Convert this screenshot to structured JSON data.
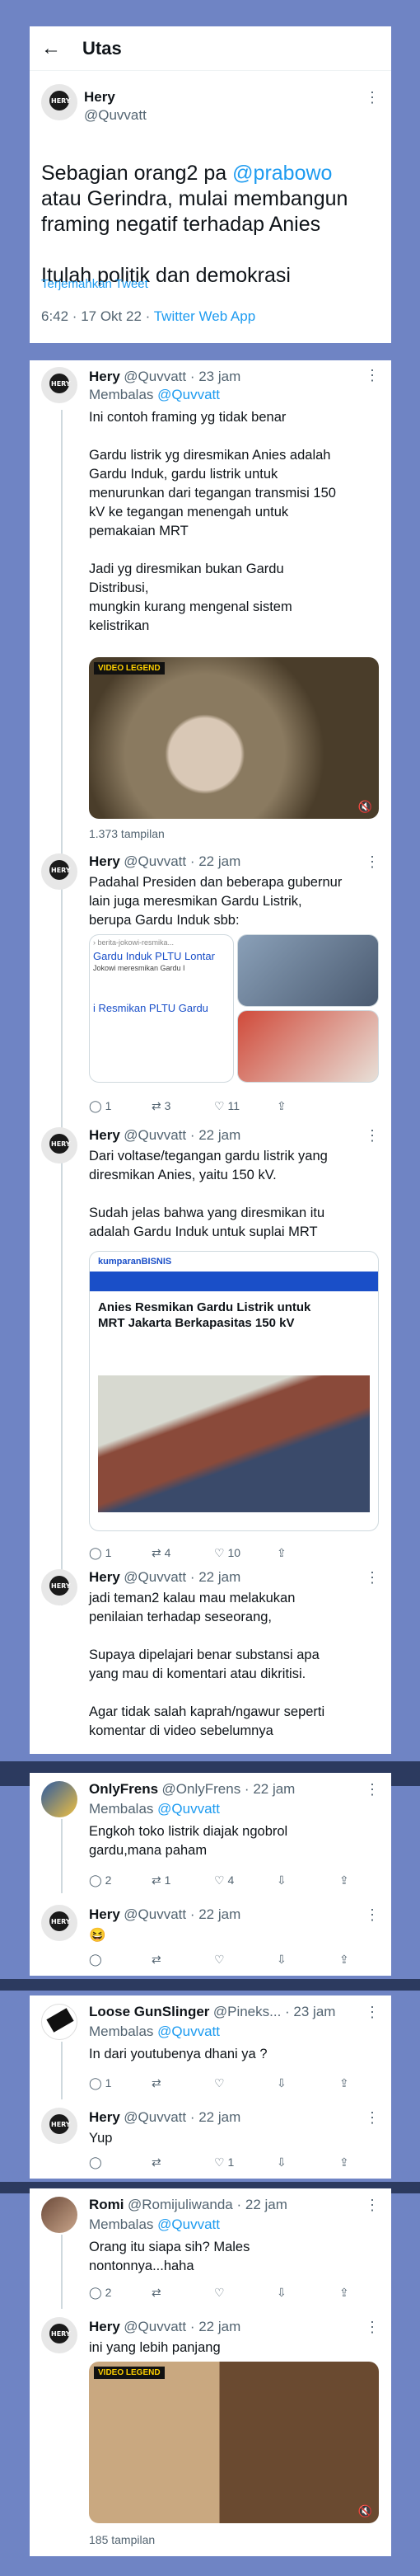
{
  "header": {
    "title": "Utas"
  },
  "main_tweet": {
    "name": "Hery",
    "handle": "@Quvvatt",
    "text_pre": "Sebagian orang2 pa ",
    "mention": "@prabowo",
    "text_post": "\natau Gerindra, mulai membangun\nframing negatif terhadap Anies\n\nItulah politik dan demokrasi",
    "translate": "Terjemahkan Tweet",
    "time": "6:42 · 17 Okt 22 · ",
    "client": "Twitter Web App"
  },
  "replies": [
    {
      "name": "Hery",
      "meta": "@Quvvatt · 23 jam",
      "reply_to": "Membalas ",
      "reply_handle": "@Quvvatt",
      "text": "Ini contoh framing yg tidak benar\n\nGardu listrik yg diresmikan Anies adalah\nGardu Induk, gardu listrik untuk\nmenurunkan dari tegangan transmisi 150\nkV ke tegangan menengah untuk\npemakaian MRT\n\nJadi yg diresmikan bukan Gardu\nDistribusi,\nmungkin kurang mengenal sistem\nkelistrikan",
      "views": "1.373 tampilan",
      "video_logo": "VIDEO LEGEND"
    },
    {
      "name": "Hery",
      "meta": "@Quvvatt · 22 jam",
      "text": "Padahal Presiden dan beberapa gubernur\nlain juga meresmikan Gardu Listrik,\nberupa Gardu Induk sbb:",
      "card1": "Gardu Induk PLTU Lontar",
      "card1_sub": "Jokowi meresmikan Gardu I",
      "card2": "i Resmikan PLTU Gardu",
      "counts": [
        "1",
        "3",
        "11",
        ""
      ]
    },
    {
      "name": "Hery",
      "meta": "@Quvvatt · 22 jam",
      "text": "Dari voltase/tegangan gardu listrik yang\ndiresmikan Anies, yaitu 150 kV.\n\nSudah jelas bahwa yang diresmikan itu\nadalah Gardu Induk untuk suplai MRT",
      "article_site": "kumparanBISNIS",
      "article_title": "Anies Resmikan Gardu Listrik untuk\nMRT Jakarta Berkapasitas 150 kV",
      "counts": [
        "1",
        "4",
        "10",
        ""
      ]
    },
    {
      "name": "Hery",
      "meta": "@Quvvatt · 22 jam",
      "text": "jadi teman2 kalau mau melakukan\npenilaian terhadap seseorang,\n\nSupaya dipelajari benar substansi apa\nyang mau di komentari atau dikritisi.\n\nAgar tidak salah kaprah/ngawur seperti\nkomentar di video sebelumnya"
    }
  ],
  "group2": {
    "first": {
      "name": "OnlyFrens",
      "meta": "@OnlyFrens · 22 jam",
      "reply_to": "Membalas ",
      "reply_handle": "@Quvvatt",
      "text": "Engkoh toko listrik diajak ngobrol\ngardu,mana paham",
      "counts": [
        "2",
        "1",
        "4",
        ""
      ]
    },
    "second": {
      "name": "Hery",
      "meta": "@Quvvatt · 22 jam",
      "text": "😆"
    }
  },
  "group3": {
    "first": {
      "name": "Loose GunSlinger",
      "meta": "@Pineks... · 23 jam",
      "reply_to": "Membalas ",
      "reply_handle": "@Quvvatt",
      "text": "In dari youtubenya dhani ya ?",
      "counts": [
        "1",
        "",
        "",
        ""
      ]
    },
    "second": {
      "name": "Hery",
      "meta": "@Quvvatt · 22 jam",
      "text": "Yup",
      "counts": [
        "",
        "",
        "1",
        ""
      ]
    }
  },
  "group4": {
    "first": {
      "name": "Romi",
      "meta": "@Romijuliwanda · 22 jam",
      "reply_to": "Membalas ",
      "reply_handle": "@Quvvatt",
      "text": "Orang itu siapa sih? Males\nnontonnya...haha",
      "counts": [
        "2",
        "",
        "",
        ""
      ]
    },
    "second": {
      "name": "Hery",
      "meta": "@Quvvatt · 22 jam",
      "text": "ini yang lebih panjang",
      "views": "185 tampilan",
      "video_logo": "VIDEO LEGEND"
    }
  }
}
